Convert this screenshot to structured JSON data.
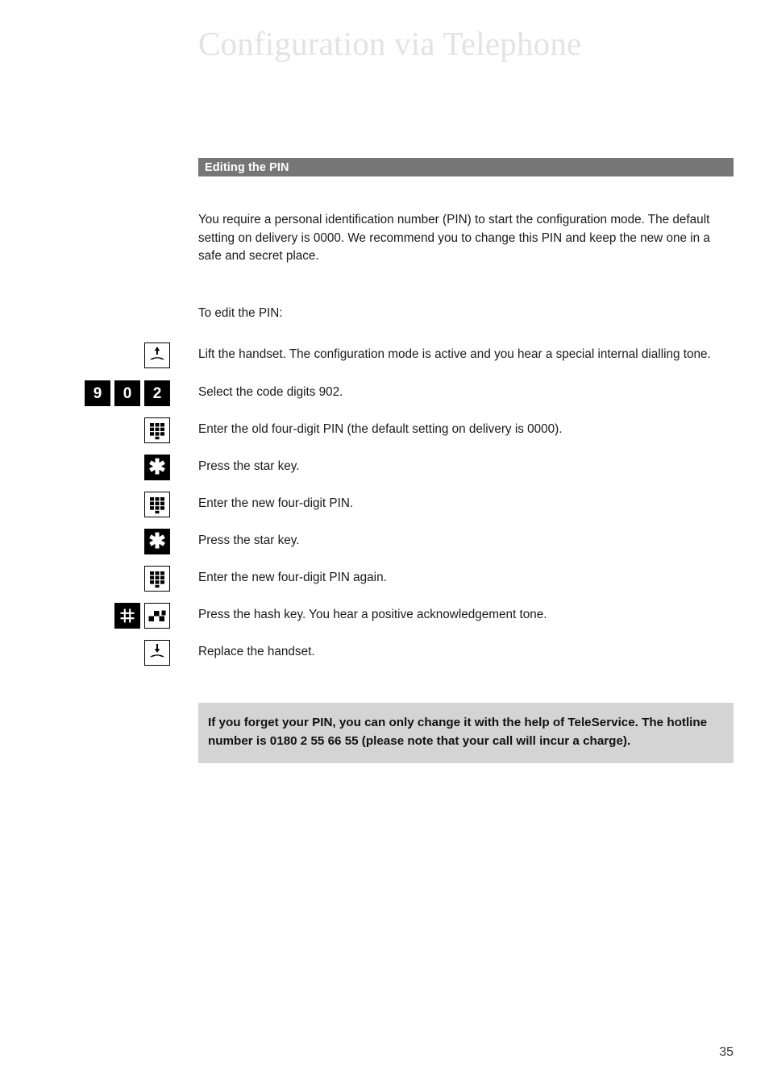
{
  "page": {
    "title": "Configuration via Telephone",
    "number": "35"
  },
  "section": {
    "heading": "Editing the PIN"
  },
  "intro": {
    "paragraph": "You require a personal identification number (PIN) to start the configuration mode. The default setting on delivery is 0000. We recommend you to change this PIN and keep the new one in a safe and secret place."
  },
  "lead": {
    "text": "To edit the PIN:"
  },
  "steps": [
    {
      "icons": [
        "handset-lift-icon"
      ],
      "text": "Lift the handset. The configuration mode is active and you hear a special internal dialling tone."
    },
    {
      "icons": [
        "key-9",
        "key-0",
        "key-2"
      ],
      "keys": [
        "9",
        "0",
        "2"
      ],
      "text": "Select the code digits 902."
    },
    {
      "icons": [
        "keypad-icon"
      ],
      "text": "Enter the old four-digit PIN (the default setting on delivery is 0000)."
    },
    {
      "icons": [
        "star-key-icon"
      ],
      "text": "Press the star key."
    },
    {
      "icons": [
        "keypad-icon"
      ],
      "text": "Enter the new four-digit PIN."
    },
    {
      "icons": [
        "star-key-icon"
      ],
      "text": "Press the star key."
    },
    {
      "icons": [
        "keypad-icon"
      ],
      "text": "Enter the new four-digit PIN again."
    },
    {
      "icons": [
        "hash-key-icon",
        "acknowledgement-tone-icon"
      ],
      "text": "Press the hash key. You hear a positive acknowledgement tone."
    },
    {
      "icons": [
        "handset-replace-icon"
      ],
      "text": "Replace the handset."
    }
  ],
  "note": {
    "text": "If you forget your PIN, you can only change it with the help of TeleService. The hotline number is 0180 2 55 66 55 (please note that your call will incur a charge)."
  },
  "colors": {
    "section_bar": "#767676",
    "note_background": "#d4d4d4",
    "title": "#e3e3e3",
    "key_background": "#000000"
  }
}
